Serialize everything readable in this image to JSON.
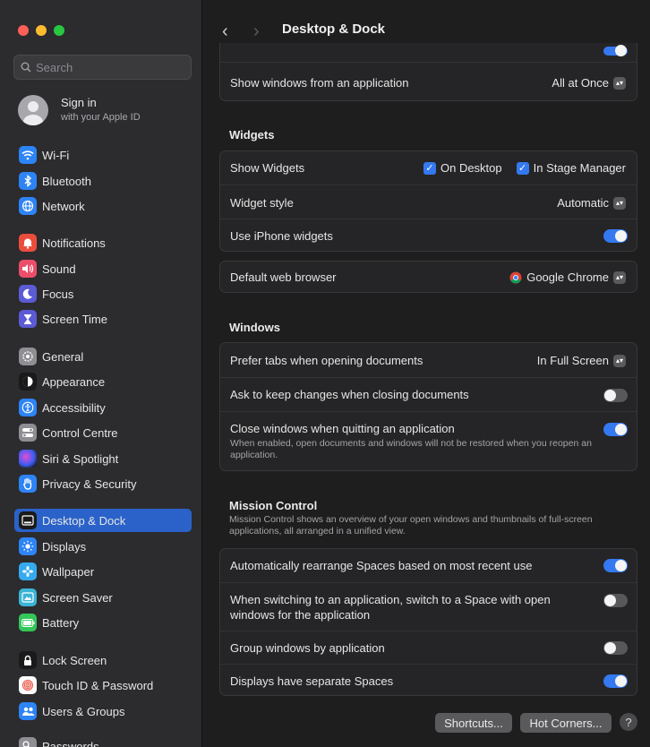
{
  "window": {
    "title": "Desktop & Dock"
  },
  "colors": {
    "accent": "#3479f0",
    "selection": "#2a62c9"
  },
  "search": {
    "placeholder": "Search"
  },
  "account": {
    "title": "Sign in",
    "subtitle": "with your Apple ID"
  },
  "sidebar": {
    "items": [
      {
        "label": "Wi-Fi",
        "icon": "wifi-icon"
      },
      {
        "label": "Bluetooth",
        "icon": "bluetooth-icon"
      },
      {
        "label": "Network",
        "icon": "globe-icon"
      },
      {
        "label": "Notifications",
        "icon": "bell-icon"
      },
      {
        "label": "Sound",
        "icon": "speaker-icon"
      },
      {
        "label": "Focus",
        "icon": "moon-icon"
      },
      {
        "label": "Screen Time",
        "icon": "hourglass-icon"
      },
      {
        "label": "General",
        "icon": "gear-icon"
      },
      {
        "label": "Appearance",
        "icon": "appearance-icon"
      },
      {
        "label": "Accessibility",
        "icon": "accessibility-icon"
      },
      {
        "label": "Control Centre",
        "icon": "switches-icon"
      },
      {
        "label": "Siri & Spotlight",
        "icon": "siri-icon"
      },
      {
        "label": "Privacy & Security",
        "icon": "hand-icon"
      },
      {
        "label": "Desktop & Dock",
        "icon": "dock-icon",
        "active": true
      },
      {
        "label": "Displays",
        "icon": "sun-icon"
      },
      {
        "label": "Wallpaper",
        "icon": "flower-icon"
      },
      {
        "label": "Screen Saver",
        "icon": "screensaver-icon"
      },
      {
        "label": "Battery",
        "icon": "battery-icon"
      },
      {
        "label": "Lock Screen",
        "icon": "lock-icon"
      },
      {
        "label": "Touch ID & Password",
        "icon": "fingerprint-icon"
      },
      {
        "label": "Users & Groups",
        "icon": "users-icon"
      },
      {
        "label": "Passwords",
        "icon": "key-icon"
      }
    ]
  },
  "top": {
    "show_windows_label": "Show windows from an application",
    "show_windows_value": "All at Once"
  },
  "widgets": {
    "title": "Widgets",
    "show_label": "Show Widgets",
    "on_desktop": "On Desktop",
    "in_stage_manager": "In Stage Manager",
    "style_label": "Widget style",
    "style_value": "Automatic",
    "iphone_label": "Use iPhone widgets"
  },
  "browser": {
    "label": "Default web browser",
    "value": "Google Chrome"
  },
  "windows": {
    "title": "Windows",
    "prefer_tabs_label": "Prefer tabs when opening documents",
    "prefer_tabs_value": "In Full Screen",
    "ask_keep_label": "Ask to keep changes when closing documents",
    "close_windows_label": "Close windows when quitting an application",
    "close_windows_desc": "When enabled, open documents and windows will not be restored when you reopen an application."
  },
  "mission": {
    "title": "Mission Control",
    "desc": "Mission Control shows an overview of your open windows and thumbnails of full-screen applications, all arranged in a unified view.",
    "rearrange_label": "Automatically rearrange Spaces based on most recent use",
    "switch_label": "When switching to an application, switch to a Space with open windows for the application",
    "group_label": "Group windows by application",
    "separate_label": "Displays have separate Spaces"
  },
  "buttons": {
    "shortcuts": "Shortcuts...",
    "hot_corners": "Hot Corners...",
    "help": "?"
  },
  "toggles": {
    "top_partial": true,
    "iphone_widgets": true,
    "ask_keep": false,
    "close_windows": true,
    "rearrange": true,
    "switch_space": false,
    "group_windows": false,
    "separate_spaces": true
  }
}
